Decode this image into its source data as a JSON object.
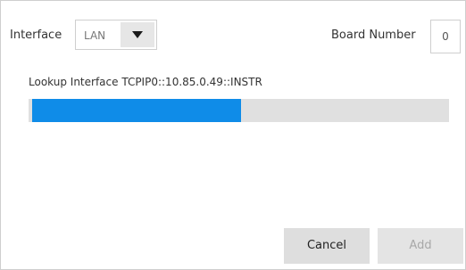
{
  "interface": {
    "label": "Interface",
    "selected": "LAN"
  },
  "board": {
    "label": "Board Number",
    "value": "0"
  },
  "lookup": {
    "text": "Lookup Interface TCPIP0::10.85.0.49::INSTR",
    "progress": 0.5
  },
  "buttons": {
    "cancel": "Cancel",
    "add": "Add"
  },
  "icons": {
    "dropdown": "triangle-down-icon"
  },
  "colors": {
    "progress_fill": "#0f8ce8",
    "progress_track": "#e0e0e0"
  }
}
